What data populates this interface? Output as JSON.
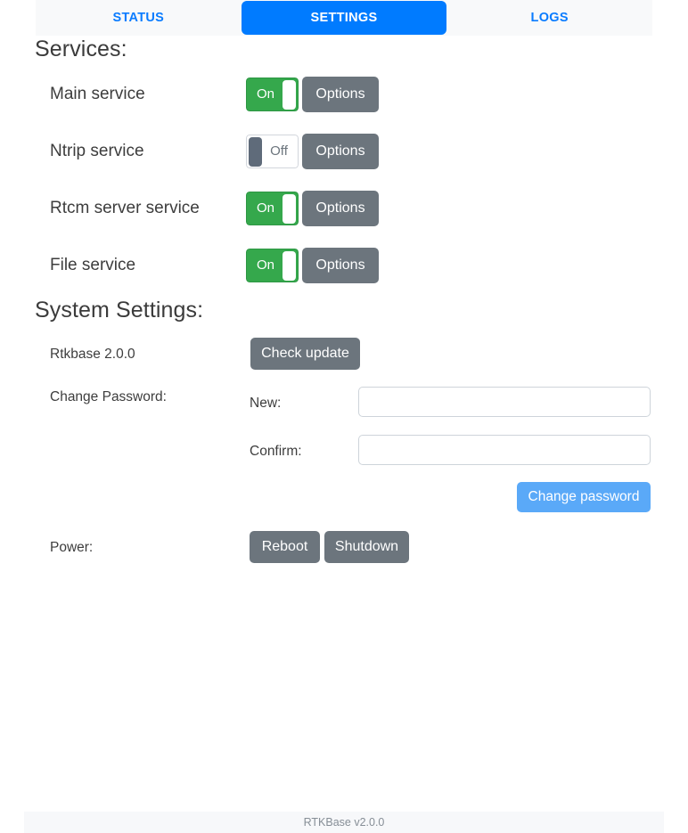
{
  "tabs": [
    {
      "label": "STATUS",
      "active": false,
      "name": "tab-status"
    },
    {
      "label": "SETTINGS",
      "active": true,
      "name": "tab-settings"
    },
    {
      "label": "LOGS",
      "active": false,
      "name": "tab-logs"
    }
  ],
  "services": {
    "heading": "Services:",
    "options_label": "Options",
    "rows": [
      {
        "label": "Main service",
        "state": "On",
        "options": "Options"
      },
      {
        "label": "Ntrip service",
        "state": "Off",
        "options": "Options"
      },
      {
        "label": "Rtcm server service",
        "state": "On",
        "options": "Options"
      },
      {
        "label": "File service",
        "state": "On",
        "options": "Options"
      }
    ]
  },
  "system": {
    "heading": "System Settings:",
    "version_label": "Rtkbase 2.0.0",
    "check_update_label": "Check update",
    "change_password_label": "Change Password:",
    "new_label": "New:",
    "new_value": "",
    "new_placeholder": "",
    "confirm_label": "Confirm:",
    "confirm_value": "",
    "confirm_placeholder": "",
    "change_password_button": "Change password",
    "power_label": "Power:",
    "reboot_label": "Reboot",
    "shutdown_label": "Shutdown"
  },
  "footer": {
    "text": "RTKBase v2.0.0"
  },
  "colors": {
    "tab_active_bg": "#007bff",
    "tab_text": "#0a7cff",
    "tab_bar_bg": "#f8f9fa",
    "toggle_on": "#35a84c",
    "toggle_off_knob": "#5f6b7a",
    "button_gray": "#6c757d",
    "button_blue": "#5aa9f8",
    "footer_bg": "#f7f8fa",
    "footer_text": "#868e96"
  }
}
